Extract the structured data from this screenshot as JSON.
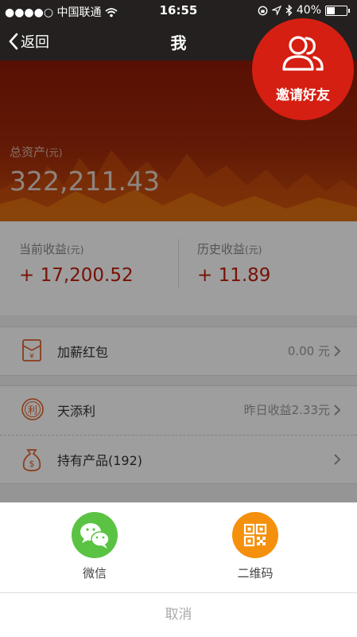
{
  "status": {
    "carrier": "●●●●○ 中国联通",
    "time": "16:55",
    "battery": "40%",
    "battery_level": 0.4
  },
  "nav": {
    "back": "返回",
    "title": "我"
  },
  "invite": {
    "label": "邀请好友",
    "icon": "users-icon"
  },
  "assets": {
    "label": "总资产",
    "unit": "(元)",
    "value": "322,211.43"
  },
  "earnings": {
    "current": {
      "label": "当前收益",
      "unit": "(元)",
      "value": "+ 17,200.52"
    },
    "history": {
      "label": "历史收益",
      "unit": "(元)",
      "value": "+ 11.89"
    }
  },
  "menu": [
    {
      "name": "加薪红包",
      "value": "0.00 元",
      "icon": "red-packet-icon"
    },
    {
      "name": "天添利",
      "value": "昨日收益2.33元",
      "icon": "li-badge-icon"
    },
    {
      "name": "持有产品(192)",
      "value": "",
      "icon": "money-bag-icon"
    }
  ],
  "share": {
    "wechat": {
      "label": "微信",
      "color": "#5bc343"
    },
    "qrcode": {
      "label": "二维码",
      "color": "#f4900c"
    },
    "cancel": "取消"
  }
}
